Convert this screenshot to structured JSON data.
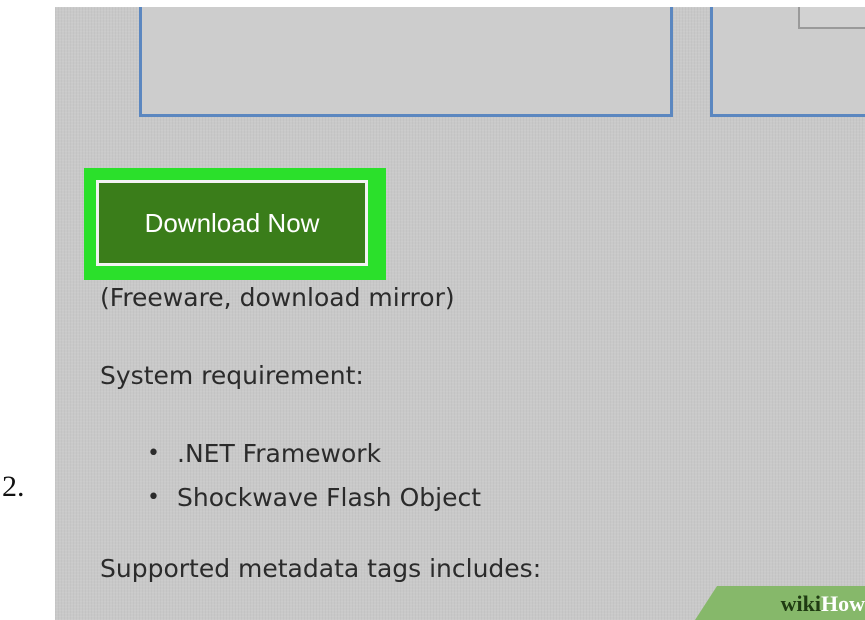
{
  "step": {
    "number": "2."
  },
  "download": {
    "button_label": "Download Now",
    "note": "(Freeware, download mirror)"
  },
  "requirements": {
    "heading": "System requirement:",
    "items": [
      ".NET Framework",
      "Shockwave Flash Object"
    ],
    "bullet": "•"
  },
  "metadata": {
    "text": "Supported metadata tags includes:"
  },
  "watermark": {
    "wiki": "wiki",
    "how": "How"
  },
  "colors": {
    "highlight": "#2be02b",
    "button_bg": "#3a7d1a",
    "panel_bg": "#c9c9c9",
    "box_border": "#5b87c0",
    "watermark_bg": "#86b86a"
  }
}
